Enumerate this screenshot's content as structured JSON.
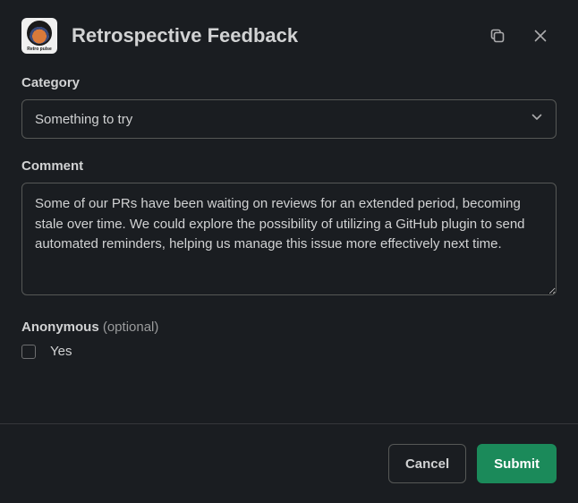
{
  "header": {
    "app_name": "Retro pulse",
    "title": "Retrospective Feedback"
  },
  "form": {
    "category": {
      "label": "Category",
      "value": "Something to try"
    },
    "comment": {
      "label": "Comment",
      "value": "Some of our PRs have been waiting on reviews for an extended period, becoming stale over time. We could explore the possibility of utilizing a GitHub plugin to send automated reminders, helping us manage this issue more effectively next time."
    },
    "anonymous": {
      "label": "Anonymous",
      "optional": "(optional)",
      "option_label": "Yes",
      "checked": false
    }
  },
  "footer": {
    "cancel": "Cancel",
    "submit": "Submit"
  }
}
